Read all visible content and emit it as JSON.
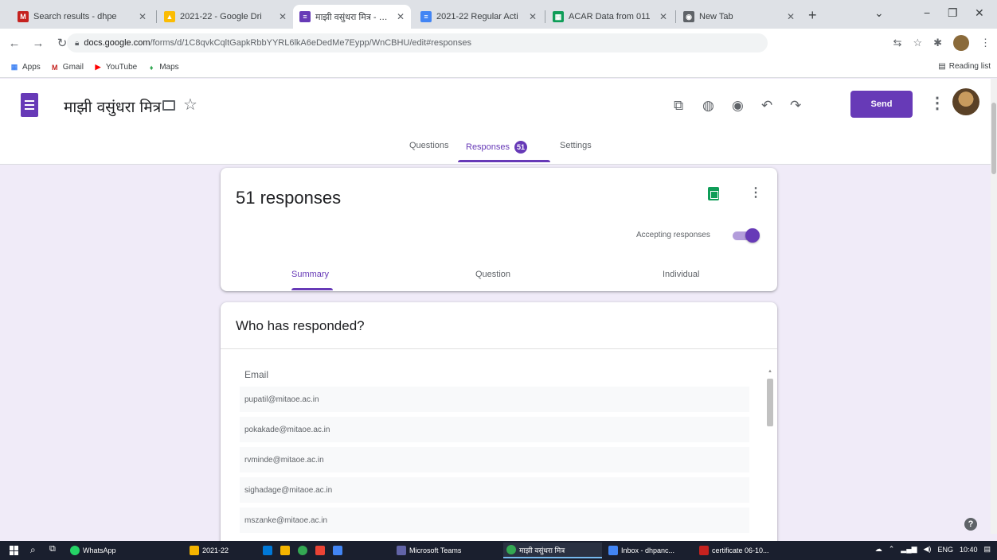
{
  "browser": {
    "tabs": [
      {
        "title": "Search results - dhpe",
        "fav_color": "#c5221f",
        "fav_glyph": "M"
      },
      {
        "title": "2021-22 - Google Dri",
        "fav_color": "#fbbc04",
        "fav_glyph": "▲"
      },
      {
        "title": "माझी वसुंधरा मित्र - Goo",
        "fav_color": "#673ab7",
        "fav_glyph": "≡"
      },
      {
        "title": "2021-22 Regular Acti",
        "fav_color": "#4285f4",
        "fav_glyph": "≡"
      },
      {
        "title": "ACAR Data from 011",
        "fav_color": "#0f9d58",
        "fav_glyph": "▦"
      },
      {
        "title": "New Tab",
        "fav_color": "#5f6368",
        "fav_glyph": "◉"
      }
    ],
    "url_host": "docs.google.com",
    "url_path": "/forms/d/1C8qvkCqltGapkRbbYYRL6lkA6eDedMe7Eypp/WnCBHU/edit#responses",
    "bookmarks": [
      {
        "label": "Apps",
        "icon": "apps-grid",
        "color": "#4285f4",
        "glyph": "▦"
      },
      {
        "label": "Gmail",
        "icon": "gmail",
        "color": "#c5221f",
        "glyph": "M"
      },
      {
        "label": "YouTube",
        "icon": "youtube",
        "color": "#ff0000",
        "glyph": "▶"
      },
      {
        "label": "Maps",
        "icon": "maps-pin",
        "color": "#34a853",
        "glyph": "♦"
      }
    ],
    "reading_list": "Reading list"
  },
  "form": {
    "title": "माझी वसुंधरा मित्र",
    "send_label": "Send",
    "tabs": {
      "questions": "Questions",
      "responses": "Responses",
      "responses_count": "51",
      "settings": "Settings"
    }
  },
  "summary_card": {
    "count_text": "51 responses",
    "accepting_label": "Accepting responses",
    "subtabs": [
      "Summary",
      "Question",
      "Individual"
    ]
  },
  "responders_card": {
    "heading": "Who has responded?",
    "column_header": "Email",
    "emails": [
      "pupatil@mitaoe.ac.in",
      "pokakade@mitaoe.ac.in",
      "rvminde@mitaoe.ac.in",
      "sighadage@mitaoe.ac.in",
      "mszanke@mitaoe.ac.in"
    ]
  },
  "taskbar": {
    "items": [
      {
        "label": "WhatsApp",
        "color": "#25d366"
      },
      {
        "label": "2021-22",
        "color": "#f4b400"
      },
      {
        "label": "Microsoft Teams",
        "color": "#6264a7"
      },
      {
        "label": "माझी वसुंधरा मित्र",
        "color": "#34a853"
      },
      {
        "label": "Inbox - dhpanc...",
        "color": "#4285f4"
      },
      {
        "label": "certificate 06-10...",
        "color": "#c5221f"
      }
    ],
    "lang": "ENG",
    "time": "10:40"
  },
  "colors": {
    "accent": "#673ab7",
    "background": "#f0ebf8",
    "sheets": "#0f9d58"
  }
}
